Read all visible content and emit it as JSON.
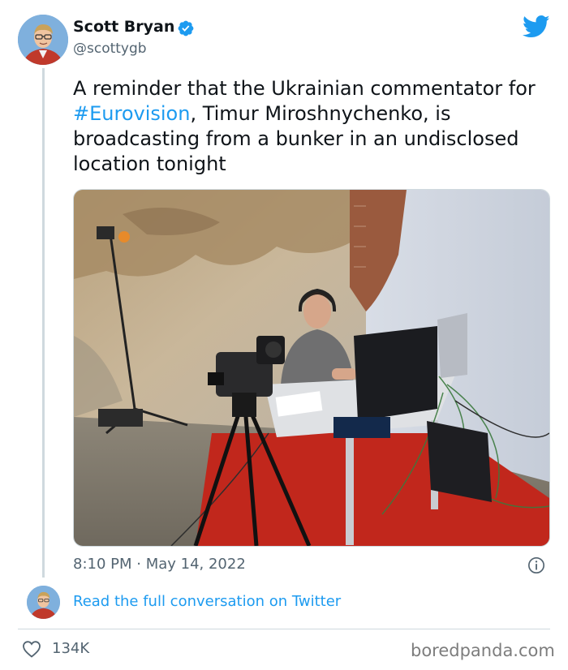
{
  "author": {
    "display_name": "Scott Bryan",
    "handle": "@scottygb",
    "verified": true
  },
  "tweet": {
    "text_before": "A reminder that the Ukrainian commentator for ",
    "hashtag": "#Eurovision",
    "text_after": ", Timur Miroshnychenko, is broadcasting from a bunker in an undisclosed location tonight",
    "timestamp": "8:10 PM · May 14, 2022",
    "likes": "134K"
  },
  "footer": {
    "read_link": "Read the full conversation on Twitter",
    "watermark": "boredpanda.com"
  },
  "icons": {
    "verified": "verified-badge-icon",
    "brand": "twitter-bird-icon",
    "info": "info-icon",
    "like": "heart-icon"
  },
  "colors": {
    "accent": "#1d9bf0",
    "text": "#0f1419",
    "muted": "#536471",
    "border": "#cfd9de"
  }
}
